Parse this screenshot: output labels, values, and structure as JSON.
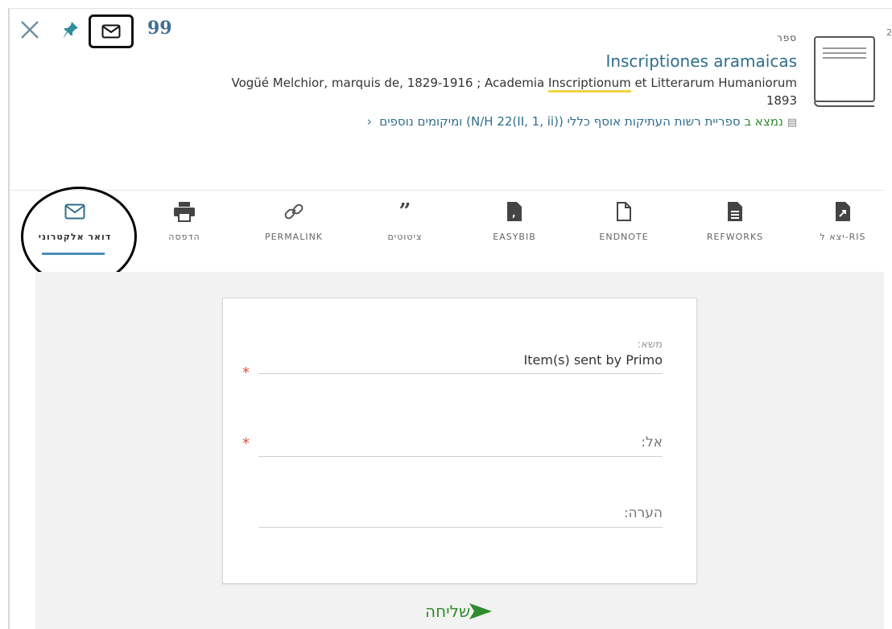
{
  "record": {
    "type": "ספר",
    "title": "Inscriptiones aramaicas",
    "creator_before": "Vogüé Melchior, marquis de, 1829-1916 ; Academia ",
    "creator_highlight": "Inscriptionum",
    "creator_after": " et Litterarum Humaniorum",
    "year": "1893",
    "availability_status": "נמצא ב",
    "availability_location": "ספריית רשות העתיקות  אוסף כללי  (N/H 22(II, 1, ii))",
    "availability_more": "ומיקומים נוספים",
    "edge_number": "2"
  },
  "top_actions": {
    "close": "close-icon",
    "pin": "pin-icon",
    "mail": "mail-icon",
    "quote": "99"
  },
  "tools": [
    {
      "label": "דואר אלקטרוני",
      "icon": "mail-icon",
      "active": true
    },
    {
      "label": "הדפסה",
      "icon": "print-icon"
    },
    {
      "label": "PERMALINK",
      "icon": "link-icon"
    },
    {
      "label": "ציטוטים",
      "icon": "quote-icon"
    },
    {
      "label": "EASYBIB",
      "icon": "easybib-icon"
    },
    {
      "label": "ENDNOTE",
      "icon": "file-icon"
    },
    {
      "label": "REFWORKS",
      "icon": "document-icon"
    },
    {
      "label": "יצא ל-RIS",
      "icon": "export-icon"
    }
  ],
  "form": {
    "subject_label": "משא:",
    "subject_value": "Item(s) sent by Primo",
    "to_placeholder": "אל:",
    "note_placeholder": "הערה:",
    "required_mark": "*",
    "send_label": "שליחה"
  },
  "colors": {
    "link": "#2f6e8c",
    "available": "#2e8b2e",
    "required": "#e0533a",
    "highlight": "#f2d33f",
    "active_tab": "#4a90b8"
  }
}
